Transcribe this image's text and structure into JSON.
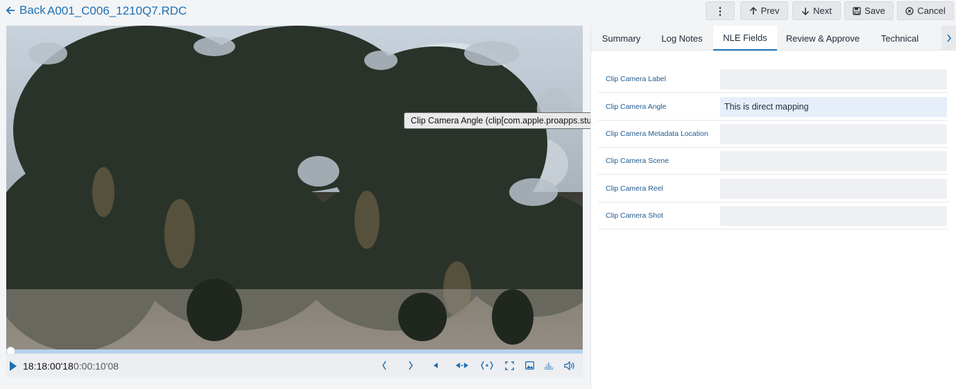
{
  "header": {
    "back_label": "Back",
    "filename": "A001_C006_1210Q7.RDC",
    "more_label": "⋮",
    "prev_label": "Prev",
    "next_label": "Next",
    "save_label": "Save",
    "cancel_label": "Cancel"
  },
  "player": {
    "timecode": "18:18:00'18",
    "duration": "0:00:10'08",
    "progress": 0.0
  },
  "tabs": [
    {
      "label": "Summary"
    },
    {
      "label": "Log Notes"
    },
    {
      "label": "NLE Fields",
      "active": true
    },
    {
      "label": "Review & Approve"
    },
    {
      "label": "Technical"
    }
  ],
  "fields": [
    {
      "label": "Clip Camera Label",
      "value": ""
    },
    {
      "label": "Clip Camera Angle",
      "value": "This is direct mapping"
    },
    {
      "label": "Clip Camera Metadata Location",
      "value": ""
    },
    {
      "label": "Clip Camera Scene",
      "value": ""
    },
    {
      "label": "Clip Camera Reel",
      "value": ""
    },
    {
      "label": "Clip Camera Shot",
      "value": ""
    }
  ],
  "tooltip": "Clip Camera Angle (clip[com.apple.proapps.studio.angle])",
  "colors": {
    "accent": "#1f6fb2"
  }
}
